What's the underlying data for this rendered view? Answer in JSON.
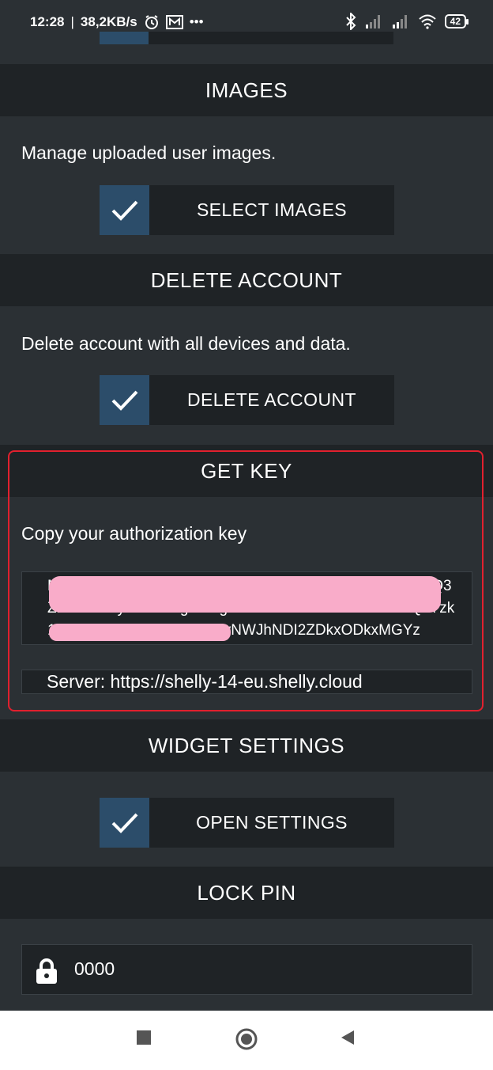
{
  "status_bar": {
    "time": "12:28",
    "network_speed": "38,2KB/s",
    "battery": "42",
    "icons": [
      "alarm-icon",
      "mail-icon",
      "more-icon",
      "bluetooth-icon",
      "signal-icon",
      "signal-icon",
      "wifi-icon",
      "battery-icon"
    ]
  },
  "images": {
    "title": "IMAGES",
    "description": "Manage uploaded user images.",
    "button_label": "SELECT IMAGES"
  },
  "delete_account": {
    "title": "DELETE ACCOUNT",
    "description": "Delete account with all devices and data.",
    "button_label": "DELETE ACCOUNT"
  },
  "get_key": {
    "title": "GET KEY",
    "description": "Copy your authorization key",
    "key_value": "MWNkOWU4ZTA0NjM1ZDE3MmQ3OTYwN2ZiMWE0ZmQ3ZDhmYTEyNTc4OTg4ODg2ODFmYTM1OTk0OTBlN2QzYzk1YTQ1MjU4YzQ1NjgzYjMyNWJhNDI2ZDkxODkxMGYz",
    "server_text": "Server: https://shelly-14-eu.shelly.cloud"
  },
  "widget_settings": {
    "title": "WIDGET SETTINGS",
    "button_label": "OPEN SETTINGS"
  },
  "lock_pin": {
    "title": "LOCK PIN",
    "value": "0000"
  },
  "colors": {
    "background": "#2b3034",
    "header": "#1f2326",
    "checkbox": "#2c4d6a",
    "highlight": "#e1202e",
    "redaction": "#f9acc9"
  }
}
